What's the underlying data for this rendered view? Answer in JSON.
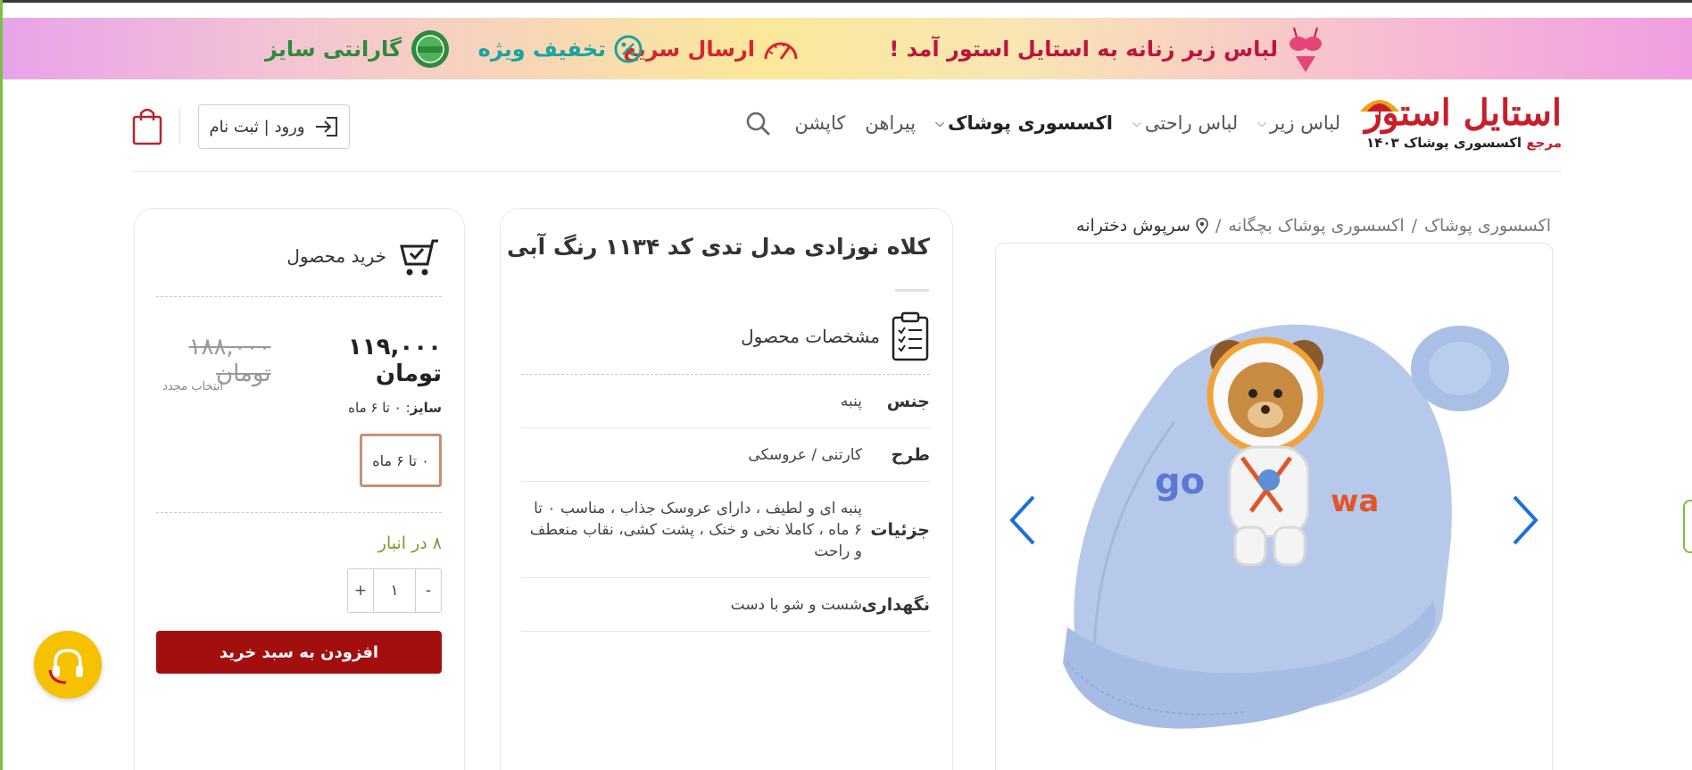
{
  "banner": {
    "message": "لباس زیر زنانه به استایل استور آمد !",
    "fast_shipping": "ارسال سریع",
    "special_discount": "تخفیف ویژه",
    "size_guarantee": "گارانتی سایز"
  },
  "logo": {
    "name": "استایل استور",
    "tagline_red": "مرجع",
    "tagline": "اکسسوری پوشاک",
    "year": "۱۴۰۳"
  },
  "nav": {
    "items": [
      {
        "label": "لباس زیر",
        "has_dropdown": true
      },
      {
        "label": "لباس راحتی",
        "has_dropdown": true
      },
      {
        "label": "اکسسوری پوشاک",
        "has_dropdown": true
      },
      {
        "label": "پیراهن",
        "has_dropdown": false
      },
      {
        "label": "کاپشن",
        "has_dropdown": false
      }
    ]
  },
  "header": {
    "login_label": "ورود | ثبت نام"
  },
  "breadcrumb": {
    "items": [
      "اکسسوری پوشاک",
      "اکسسوری پوشاک بچگانه"
    ],
    "current": "سرپوش دخترانه"
  },
  "product": {
    "title": "کلاه نوزادی مدل تدی کد ۱۱۳۴ رنگ آبی"
  },
  "specs": {
    "heading": "مشخصات محصول",
    "rows": [
      {
        "key": "جنس",
        "value": "پنبه"
      },
      {
        "key": "طرح",
        "value": "کارتنی / عروسکی"
      },
      {
        "key": "جزئیات",
        "value": "پنبه ای و لطیف ، دارای عروسک جذاب ، مناسب ۰ تا ۶ ماه ، کاملا نخی و خنک ، پشت کشی، نقاب منعطف و راحت"
      },
      {
        "key": "نگهداری",
        "value": "شست و شو با دست"
      }
    ]
  },
  "purchase": {
    "heading": "خرید محصول",
    "price_new": "۱۱۹,۰۰۰ تومان",
    "price_old": "۱۸۸,۰۰۰ تومان",
    "reset_label": "انتخاب مجدد",
    "size_label": "سایز",
    "size_value": "۰ تا ۶ ماه",
    "size_option": "۰ تا ۶ ماه",
    "stock": "۸ در انبار",
    "quantity": "۱",
    "minus": "-",
    "plus": "+",
    "add_to_cart": "افزودن به سبد خرید"
  },
  "colors": {
    "accent_red": "#a30e0e",
    "stock_green": "#7a9a2e",
    "slider_arrow": "#1e6fd9",
    "support_yellow": "#f5c100"
  }
}
